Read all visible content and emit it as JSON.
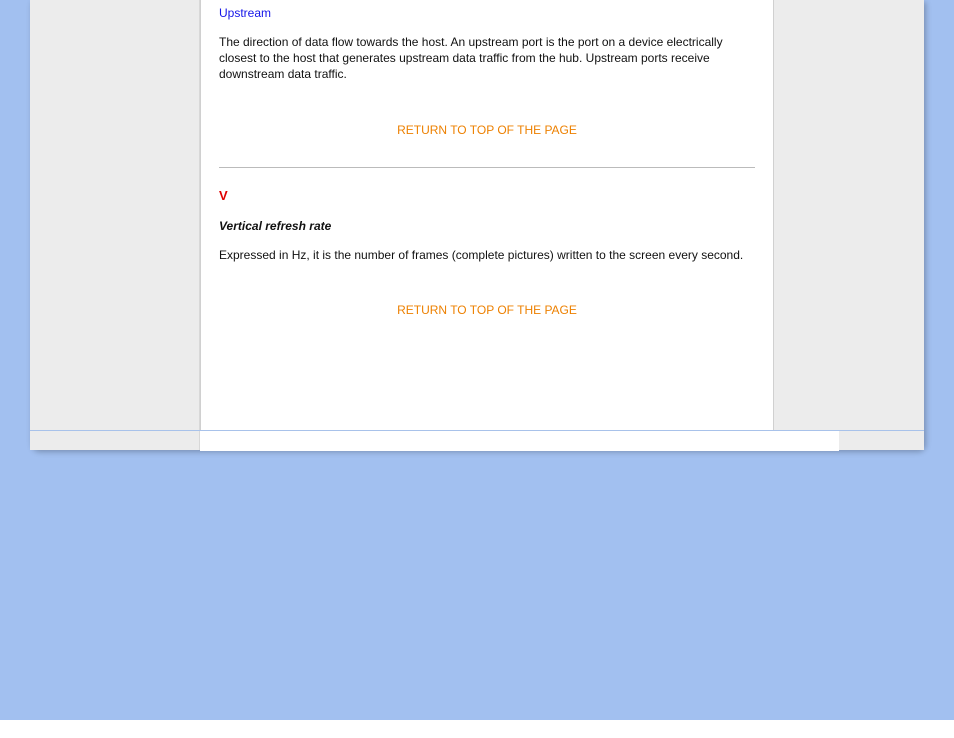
{
  "sectionU": {
    "term": "Upstream",
    "desc": "The direction of data flow towards the host. An upstream port is the port on a device electrically closest to the host that generates upstream data traffic from the hub. Upstream ports receive downstream data traffic."
  },
  "returnLink": "RETURN TO TOP OF THE PAGE",
  "sectionV": {
    "letter": "V",
    "term": "Vertical refresh rate",
    "desc": "Expressed in Hz, it is the number of frames (complete pictures) written to the screen every second."
  }
}
